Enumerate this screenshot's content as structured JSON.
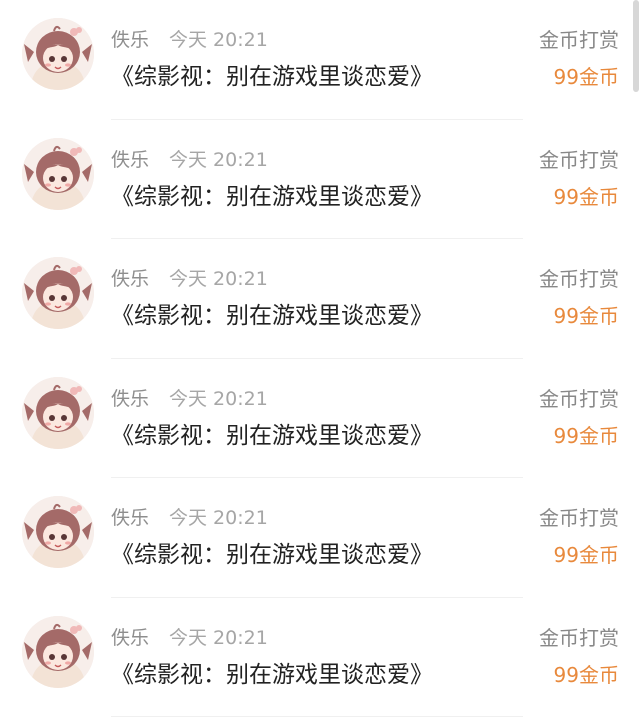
{
  "rows": [
    {
      "user": "佚乐",
      "time": "今天 20:21",
      "book_title": "《综影视：别在游戏里谈恋爱》",
      "reward_type": "金币打赏",
      "reward_amount": "99金币"
    },
    {
      "user": "佚乐",
      "time": "今天 20:21",
      "book_title": "《综影视：别在游戏里谈恋爱》",
      "reward_type": "金币打赏",
      "reward_amount": "99金币"
    },
    {
      "user": "佚乐",
      "time": "今天 20:21",
      "book_title": "《综影视：别在游戏里谈恋爱》",
      "reward_type": "金币打赏",
      "reward_amount": "99金币"
    },
    {
      "user": "佚乐",
      "time": "今天 20:21",
      "book_title": "《综影视：别在游戏里谈恋爱》",
      "reward_type": "金币打赏",
      "reward_amount": "99金币"
    },
    {
      "user": "佚乐",
      "time": "今天 20:21",
      "book_title": "《综影视：别在游戏里谈恋爱》",
      "reward_type": "金币打赏",
      "reward_amount": "99金币"
    },
    {
      "user": "佚乐",
      "time": "今天 20:21",
      "book_title": "《综影视：别在游戏里谈恋爱》",
      "reward_type": "金币打赏",
      "reward_amount": "99金币"
    }
  ],
  "colors": {
    "amount": "#e8893c",
    "title": "#222222",
    "meta": "#8e8e8e"
  },
  "icons": {
    "avatar": "anime-girl-avatar-icon"
  }
}
